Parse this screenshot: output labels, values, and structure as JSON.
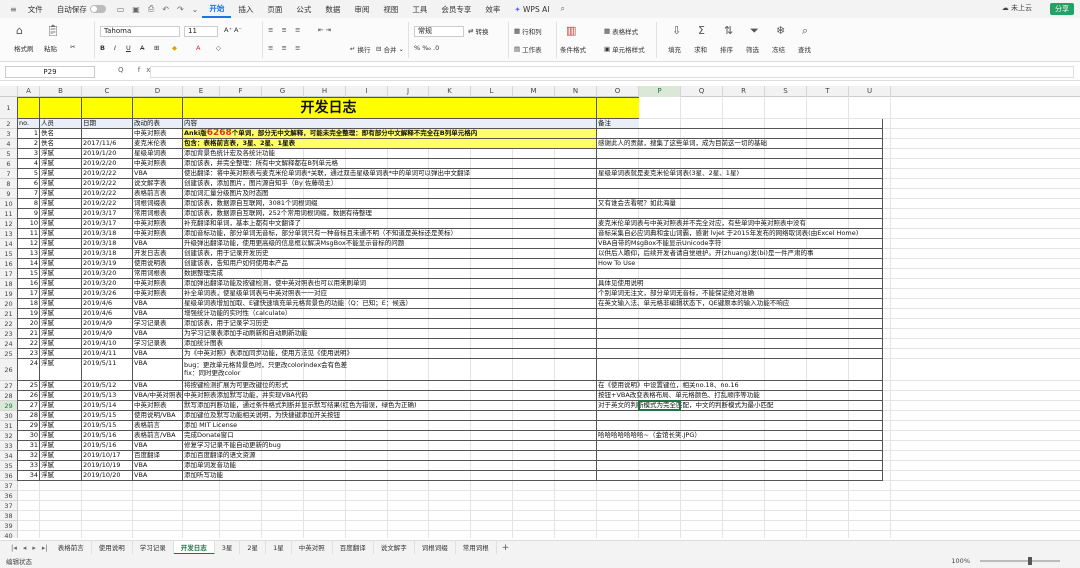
{
  "topbar": {
    "file": "文件",
    "autosave": "自动保存",
    "tabs": [
      "开始",
      "插入",
      "页面",
      "公式",
      "数据",
      "审阅",
      "视图",
      "工具",
      "会员专享",
      "效率"
    ],
    "active_tab": "开始",
    "wps_ai": "WPS AI",
    "cloud_status": "未上云",
    "share": "分享"
  },
  "ribbon": {
    "format_painter": "格式刷",
    "paste": "粘贴",
    "font_name": "Tahoma",
    "font_size": "11",
    "bold": "B",
    "italic": "I",
    "underline": "U",
    "wrap": "换行",
    "merge": "合并",
    "number_format": "常规",
    "convert": "转换",
    "row_col": "行和列",
    "worksheet": "工作表",
    "conditional_format": "条件格式",
    "table_style": "表格样式",
    "cell_style": "单元格样式",
    "fill": "填充",
    "sum": "求和",
    "sort": "排序",
    "filter": "筛选",
    "freeze": "冻结",
    "find": "查找"
  },
  "formula_bar": {
    "cell_ref": "P29",
    "fx": "Q fx",
    "content": ""
  },
  "grid": {
    "columns": [
      "A",
      "B",
      "C",
      "D",
      "E",
      "F",
      "G",
      "H",
      "I",
      "J",
      "K",
      "L",
      "M",
      "N",
      "O",
      "P",
      "Q",
      "R",
      "S",
      "T",
      "U"
    ],
    "selected_column": "P",
    "selected_row": "29",
    "title": "开发日志",
    "headers": [
      "no.",
      "人员",
      "日期",
      "改动的表",
      "内容",
      "备注"
    ],
    "rows": [
      {
        "n": "1",
        "no": "1",
        "who": "佚名",
        "date": "",
        "table": "中英对照表",
        "content_pre": "Anki版",
        "content_red": "6268",
        "content_post": "个单词，部分无中文解释，可能未完全整理：即有部分中文解释不完全在B列单元格内",
        "note": "",
        "bold": true,
        "yellow": true
      },
      {
        "n": "2",
        "no": "2",
        "who": "佚名",
        "date": "2017/11/6",
        "table": "麦克米伦表",
        "content": "包含：表格前言表，3星、2星、1星表",
        "note": "感谢此人的贡献，搜集了这些单词，成为目前这一切的基础",
        "bold": true,
        "yellow": true
      },
      {
        "n": "3",
        "no": "3",
        "who": "浮腻",
        "date": "2019/1/20",
        "table": "星级单词表",
        "content": "添加背景色统计宏及各统计功能",
        "note": ""
      },
      {
        "n": "4",
        "no": "4",
        "who": "浮腻",
        "date": "2019/2/20",
        "table": "中英对照表",
        "content": "添加该表，并完全整理：所有中文解释都在B列单元格",
        "note": ""
      },
      {
        "n": "5",
        "no": "5",
        "who": "浮腻",
        "date": "2019/2/22",
        "table": "VBA",
        "content": "使出翻译：将中英对照表与麦克米伦单词表*关联，通过双击星级单词表*中的单词可以弹出中文翻译",
        "note": "星级单词表就是麦克米伦单词表(3星、2星、1星)"
      },
      {
        "n": "6",
        "no": "6",
        "who": "浮腻",
        "date": "2019/2/22",
        "table": "说文解字表",
        "content": "创建该表，添加图片，图片源自知乎（By 佐藤萌主）",
        "note": ""
      },
      {
        "n": "7",
        "no": "7",
        "who": "浮腻",
        "date": "2019/2/22",
        "table": "表格前言表",
        "content": "添加词汇量分级图片及时态图",
        "note": ""
      },
      {
        "n": "8",
        "no": "8",
        "who": "浮腻",
        "date": "2019/2/22",
        "table": "词根词缀表",
        "content": "添加该表，数据源自互联网，3081个词根词缀",
        "note": "又有谁会去看呢？如此海量"
      },
      {
        "n": "9",
        "no": "9",
        "who": "浮腻",
        "date": "2019/3/17",
        "table": "常用词根表",
        "content": "添加该表，数据源自互联网，252个常用词根词缀，数据有待整理",
        "note": ""
      },
      {
        "n": "10",
        "no": "10",
        "who": "浮腻",
        "date": "2019/3/17",
        "table": "中英对照表",
        "content": "补充翻译和单词，基本上都有中文翻译了",
        "note": "麦克米伦单词表与中英对照表并不完全对应，有些单词中英对照表中没有"
      },
      {
        "n": "11",
        "no": "11",
        "who": "浮腻",
        "date": "2019/3/18",
        "table": "中英对照表",
        "content": "添加音标功能，部分单词无音标，部分单词只有一种音标且未通不明（不知道是英标还是美标）",
        "note": "音标采集自必应词典和金山词霸，感谢 lvjet 于2015年发布的网络取词表(由Excel Home)"
      },
      {
        "n": "12",
        "no": "12",
        "who": "浮腻",
        "date": "2019/3/18",
        "table": "VBA",
        "content": "升级弹出翻译功能，使用更高级的信息框以解决MsgBox不能显示音标的问题",
        "note": "VBA自带的MsgBox不能显示Unicode字符"
      },
      {
        "n": "13",
        "no": "13",
        "who": "浮腻",
        "date": "2019/3/18",
        "table": "开发日志表",
        "content": "创建该表，用于记录开发历史",
        "note": "以供后人瞻仰，后续开发者请自觉维护。开(zhuang)发(bi)是一件严肃的事"
      },
      {
        "n": "14",
        "no": "14",
        "who": "浮腻",
        "date": "2019/3/19",
        "table": "使用说明表",
        "content": "创建该表，告知用户如何使用本产品",
        "note": "How To Use"
      },
      {
        "n": "15",
        "no": "15",
        "who": "浮腻",
        "date": "2019/3/20",
        "table": "常用词根表",
        "content": "数据整理完成",
        "note": ""
      },
      {
        "n": "16",
        "no": "16",
        "who": "浮腻",
        "date": "2019/3/20",
        "table": "中英对照表",
        "content": "添加弹出翻译功能及按键检测，使中英对照表也可以用来刷单词",
        "note": "具体见使用说明"
      },
      {
        "n": "17",
        "no": "17",
        "who": "浮腻",
        "date": "2019/3/26",
        "table": "中英对照表",
        "content": "补全单词表，使星级单词表与中英对照表一一对应",
        "note": "个别单词无注文，部分单词无音标，不能保证绝对准确"
      },
      {
        "n": "18",
        "no": "18",
        "who": "浮腻",
        "date": "2019/4/6",
        "table": "VBA",
        "content": "星级单词表增加加取、E键快速填充单元格背景色的功能（Q：已知；E：候选）",
        "note": "在英文输入法、单元格非编辑状态下，QE键原本的输入功能不响应"
      },
      {
        "n": "19",
        "no": "19",
        "who": "浮腻",
        "date": "2019/4/6",
        "table": "VBA",
        "content": "增强统计功能的实时性（calculate）",
        "note": ""
      },
      {
        "n": "20",
        "no": "20",
        "who": "浮腻",
        "date": "2019/4/9",
        "table": "学习记录表",
        "content": "添加该表，用于记录学习历史",
        "note": ""
      },
      {
        "n": "21",
        "no": "21",
        "who": "浮腻",
        "date": "2019/4/9",
        "table": "VBA",
        "content": "为学习记录表添加手动刷新和自动刷新功能",
        "note": ""
      },
      {
        "n": "22",
        "no": "22",
        "who": "浮腻",
        "date": "2019/4/10",
        "table": "学习记录表",
        "content": "添加统计图表",
        "note": ""
      },
      {
        "n": "23",
        "no": "23",
        "who": "浮腻",
        "date": "2019/4/11",
        "table": "VBA",
        "content": "为《中英对照》表添加同步功能，使用方法见《使用说明》",
        "note": ""
      },
      {
        "n": "24",
        "no": "24",
        "who": "浮腻",
        "date": "2019/5/11",
        "table": "VBA",
        "content": "bug：更改单元格背景色时，只更改colorindex会有色差\nfix：同时更改color",
        "note": "",
        "tall": true
      },
      {
        "n": "25",
        "no": "25",
        "who": "浮腻",
        "date": "2019/5/12",
        "table": "VBA",
        "content": "将按键检测扩展为可更改键位的形式",
        "note": "在《使用说明》中设置键位，相关no.18、no.16"
      },
      {
        "n": "26",
        "no": "26",
        "who": "浮腻",
        "date": "2019/5/13",
        "table": "VBA/中英对照表",
        "content": "中英对照表添加默写功能，并实现VBA代码",
        "note": "按钮+VBA改变表格布局、单元格颜色、打乱顺序等功能"
      },
      {
        "n": "27",
        "no": "27",
        "who": "浮腻",
        "date": "2019/5/14",
        "table": "中英对照表",
        "content": "默写添加判断功能，通过条件格式判断并显示默写结果(红色为错误，绿色为正确)",
        "note": "对于英文的判断模式为完全匹配，中文的判断模式为最小匹配"
      },
      {
        "n": "28",
        "no": "28",
        "who": "浮腻",
        "date": "2019/5/15",
        "table": "使用说明/VBA",
        "content": "添加键位及默写功能相关说明，为快捷键添加开关按钮",
        "note": ""
      },
      {
        "n": "29",
        "no": "29",
        "who": "浮腻",
        "date": "2019/5/15",
        "table": "表格前言",
        "content": "添加 MIT License",
        "note": ""
      },
      {
        "n": "30",
        "no": "30",
        "who": "浮腻",
        "date": "2019/5/16",
        "table": "表格前言/VBA",
        "content": "完成Donate窗口",
        "note": "哈哈哈哈哈哈哈~（金馆长笑.JPG）"
      },
      {
        "n": "31",
        "no": "31",
        "who": "浮腻",
        "date": "2019/5/16",
        "table": "VBA",
        "content": "修复学习记录不能自动更新的bug",
        "note": ""
      },
      {
        "n": "32",
        "no": "32",
        "who": "浮腻",
        "date": "2019/10/17",
        "table": "百度翻译",
        "content": "添加百度翻译的语文资源",
        "note": ""
      },
      {
        "n": "33",
        "no": "33",
        "who": "浮腻",
        "date": "2019/10/19",
        "table": "VBA",
        "content": "添加单词发音功能",
        "note": ""
      },
      {
        "n": "34",
        "no": "34",
        "who": "浮腻",
        "date": "2019/10/20",
        "table": "VBA",
        "content": "添加听写功能",
        "note": ""
      }
    ],
    "empty_rows": [
      "36",
      "37",
      "38",
      "39",
      "40"
    ]
  },
  "sheet_tabs": [
    "表格前言",
    "使用说明",
    "学习记录",
    "开发日志",
    "3星",
    "2星",
    "1星",
    "中英对照",
    "百度翻译",
    "说文解字",
    "词根词缀",
    "常用词根"
  ],
  "active_sheet": "开发日志",
  "statusbar": {
    "mode": "编辑状态",
    "zoom": "100%"
  },
  "colors": {
    "accent": "#217346",
    "title_fill": "#ffff00",
    "highlight_red": "#e03030",
    "share_green": "#21a366"
  }
}
